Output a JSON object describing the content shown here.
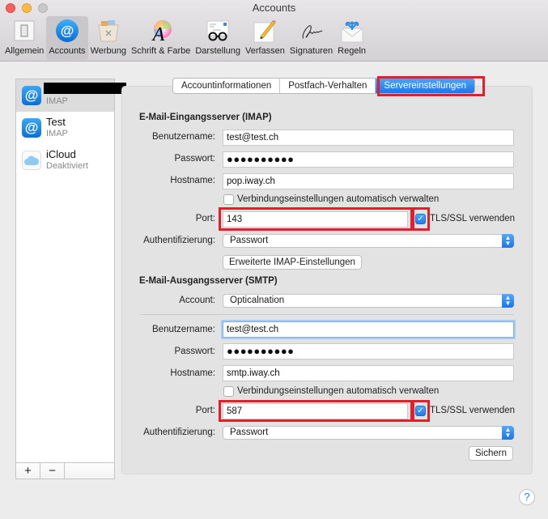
{
  "window": {
    "title": "Accounts"
  },
  "toolbar": {
    "items": [
      {
        "label": "Allgemein",
        "icon": "switch-icon",
        "active": false
      },
      {
        "label": "Accounts",
        "icon": "at-icon",
        "active": true
      },
      {
        "label": "Werbung",
        "icon": "junk-bin-icon",
        "active": false
      },
      {
        "label": "Schrift & Farbe",
        "icon": "font-color-icon",
        "active": false
      },
      {
        "label": "Darstellung",
        "icon": "glasses-icon",
        "active": false
      },
      {
        "label": "Verfassen",
        "icon": "pencil-icon",
        "active": false
      },
      {
        "label": "Signaturen",
        "icon": "signature-icon",
        "active": false
      },
      {
        "label": "Regeln",
        "icon": "rules-envelope-icon",
        "active": false
      }
    ]
  },
  "sidebar": {
    "accounts": [
      {
        "name": "",
        "type": "IMAP",
        "icon": "at-icon",
        "selected": true,
        "redacted": true
      },
      {
        "name": "Test",
        "type": "IMAP",
        "icon": "at-icon",
        "selected": false
      },
      {
        "name": "iCloud",
        "type": "Deaktiviert",
        "icon": "cloud-icon",
        "selected": false
      }
    ],
    "add_label": "+",
    "remove_label": "−"
  },
  "tabs": [
    {
      "label": "Accountinformationen",
      "active": false
    },
    {
      "label": "Postfach-Verhalten",
      "active": false
    },
    {
      "label": "Servereinstellungen",
      "active": true
    }
  ],
  "incoming": {
    "title": "E-Mail-Eingangsserver (IMAP)",
    "username_label": "Benutzername:",
    "username": "test@test.ch",
    "password_label": "Passwort:",
    "password": "●●●●●●●●●●",
    "hostname_label": "Hostname:",
    "hostname": "pop.iway.ch",
    "auto_manage_label": "Verbindungseinstellungen automatisch verwalten",
    "auto_manage_checked": false,
    "port_label": "Port:",
    "port": "143",
    "tls_label": "TLS/SSL verwenden",
    "tls_checked": true,
    "auth_label": "Authentifizierung:",
    "auth": "Passwort",
    "advanced_button": "Erweiterte IMAP-Einstellungen"
  },
  "outgoing": {
    "title": "E-Mail-Ausgangsserver (SMTP)",
    "account_label": "Account:",
    "account": "Opticalnation",
    "username_label": "Benutzername:",
    "username": "test@test.ch",
    "password_label": "Passwort:",
    "password": "●●●●●●●●●●",
    "hostname_label": "Hostname:",
    "hostname": "smtp.iway.ch",
    "auto_manage_label": "Verbindungseinstellungen automatisch verwalten",
    "auto_manage_checked": false,
    "port_label": "Port:",
    "port": "587",
    "tls_label": "TLS/SSL verwenden",
    "tls_checked": true,
    "auth_label": "Authentifizierung:",
    "auth": "Passwort"
  },
  "save_button": "Sichern",
  "help_label": "?",
  "checkmark": "✓",
  "stepper_glyph": "⌃⌄",
  "colors": {
    "accent": "#1a78ea",
    "highlight": "#e41e2a"
  }
}
